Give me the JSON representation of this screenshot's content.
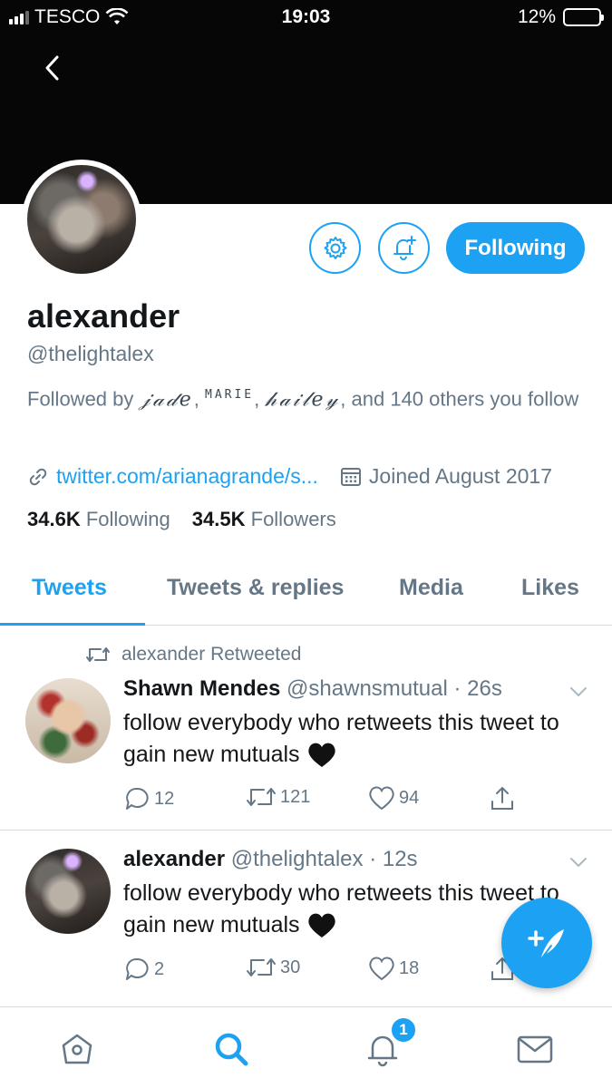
{
  "status": {
    "carrier": "TESCO",
    "time": "19:03",
    "battery": "12%"
  },
  "profile": {
    "name": "alexander",
    "handle": "@thelightalex",
    "followed_by_prefix": "Followed by",
    "followed_by_names": [
      "𝒿𝒶𝒹𝑒",
      "MARIE",
      "𝒽𝒶𝒾𝓁𝑒𝓎"
    ],
    "followed_by_suffix": ", and 140 others you follow",
    "link": "twitter.com/arianagrande/s...",
    "joined": "Joined August 2017",
    "following_count": "34.6K",
    "following_label": "Following",
    "followers_count": "34.5K",
    "followers_label": "Followers",
    "follow_button": "Following"
  },
  "tabs": [
    "Tweets",
    "Tweets & replies",
    "Media",
    "Likes"
  ],
  "tweets": [
    {
      "retweeted_by": "alexander Retweeted",
      "name": "Shawn Mendes",
      "handle_time": "@shawnsmutual · 26s",
      "text": "follow everybody who retweets this tweet to gain new mutuals",
      "replies": "12",
      "retweets": "121",
      "likes": "94"
    },
    {
      "name": "alexander",
      "handle_time": "@thelightalex · 12s",
      "text": "follow everybody who retweets this tweet to gain new mutuals",
      "replies": "2",
      "retweets": "30",
      "likes": "18"
    }
  ],
  "nav": {
    "notification_badge": "1"
  },
  "colors": {
    "accent": "#1da1f2",
    "muted": "#657786"
  }
}
